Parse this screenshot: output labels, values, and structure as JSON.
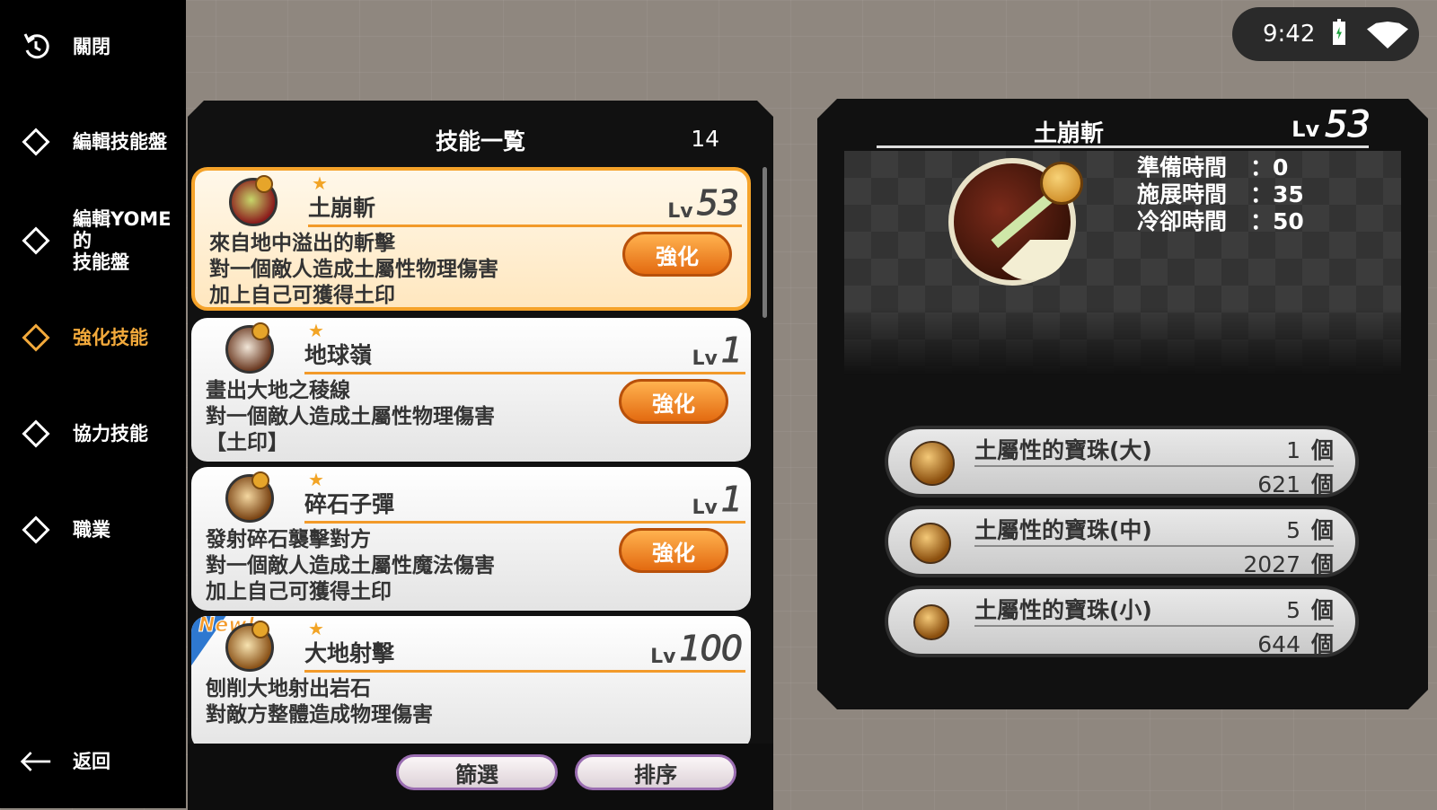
{
  "sidebar": {
    "items": [
      {
        "label": "關閉",
        "icon": "undo-icon"
      },
      {
        "label": "編輯技能盤",
        "icon": "diamond-icon"
      },
      {
        "label": "編輯YOME的\n技能盤",
        "icon": "diamond-icon"
      },
      {
        "label": "強化技能",
        "icon": "diamond-icon",
        "active": true
      },
      {
        "label": "協力技能",
        "icon": "diamond-icon"
      },
      {
        "label": "職業",
        "icon": "diamond-icon"
      }
    ],
    "back_label": "返回"
  },
  "status_bar": {
    "time": "9:42"
  },
  "skill_list": {
    "title": "技能一覧",
    "count": "14",
    "enhance_label": "強化",
    "lv_label": "Lv",
    "new_label": "New!",
    "skills": [
      {
        "name": "土崩斬",
        "level": "53",
        "desc": "來自地中溢出的斬擊\n對一個敵人造成土屬性物理傷害\n加上自己可獲得土印",
        "selected": true
      },
      {
        "name": "地球嶺",
        "level": "1",
        "desc": "畫出大地之稜線\n對一個敵人造成土屬性物理傷害\n【土印】"
      },
      {
        "name": "碎石子彈",
        "level": "1",
        "desc": "發射碎石襲擊對方\n對一個敵人造成土屬性魔法傷害\n加上自己可獲得土印"
      },
      {
        "name": "大地射擊",
        "level": "100",
        "desc": "刨削大地射出岩石\n對敵方整體造成物理傷害",
        "is_new": true
      }
    ],
    "filter_label": "篩選",
    "sort_label": "排序"
  },
  "detail": {
    "name": "土崩斬",
    "lv_label": "Lv",
    "level": "53",
    "stats": [
      {
        "key": "準備時間",
        "value": "0"
      },
      {
        "key": "施展時間",
        "value": "35"
      },
      {
        "key": "冷卻時間",
        "value": "50"
      }
    ],
    "unit": "個",
    "materials": [
      {
        "name": "土屬性的寶珠(大)",
        "required": "1",
        "owned": "621"
      },
      {
        "name": "土屬性的寶珠(中)",
        "required": "5",
        "owned": "2027"
      },
      {
        "name": "土屬性的寶珠(小)",
        "required": "5",
        "owned": "644"
      }
    ]
  },
  "colors": {
    "accent": "#f2a93b",
    "enhance_button": "#f07d1c",
    "sidebar_bg": "#000000"
  }
}
